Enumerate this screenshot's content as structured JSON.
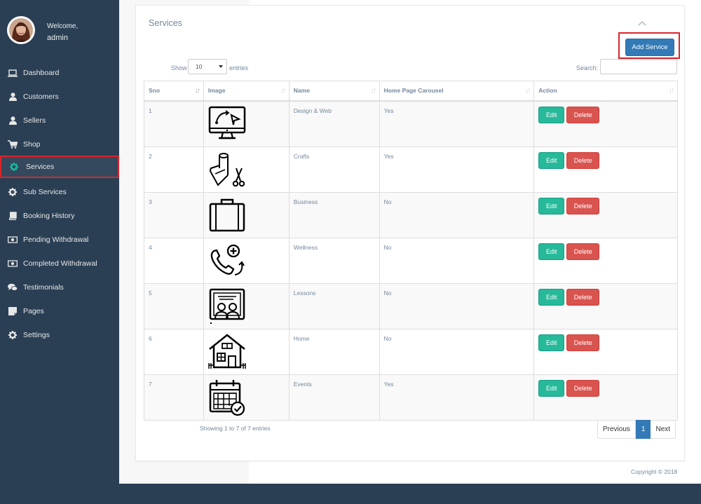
{
  "sidebar": {
    "welcome": "Welcome,",
    "username": "admin",
    "items": [
      {
        "label": "Dashboard",
        "icon": "laptop-icon"
      },
      {
        "label": "Customers",
        "icon": "user-icon"
      },
      {
        "label": "Sellers",
        "icon": "user-icon"
      },
      {
        "label": "Shop",
        "icon": "cart-icon"
      },
      {
        "label": "Services",
        "icon": "gear-icon",
        "active": true
      },
      {
        "label": "Sub Services",
        "icon": "gear-icon"
      },
      {
        "label": "Booking History",
        "icon": "book-icon"
      },
      {
        "label": "Pending Withdrawal",
        "icon": "money-icon"
      },
      {
        "label": "Completed Withdrawal",
        "icon": "money-icon"
      },
      {
        "label": "Testimonials",
        "icon": "comments-icon"
      },
      {
        "label": "Pages",
        "icon": "sticky-note-icon"
      },
      {
        "label": "Settings",
        "icon": "gear-icon"
      }
    ]
  },
  "panel": {
    "title": "Services",
    "add_button": "Add Service"
  },
  "table_controls": {
    "show": "Show",
    "entries_value": "10",
    "entries": "entries",
    "search_label": "Search:",
    "search_value": ""
  },
  "table": {
    "headers": [
      "Sno",
      "Image",
      "Name",
      "Home Page Carousel",
      "Action"
    ],
    "rows": [
      {
        "sno": "1",
        "image": "computer-screen-icon",
        "name": "Design & Web",
        "carousel": "Yes"
      },
      {
        "sno": "2",
        "image": "fabric-scissors-icon",
        "name": "Crafts",
        "carousel": "Yes"
      },
      {
        "sno": "3",
        "image": "briefcase-icon",
        "name": "Business",
        "carousel": "No"
      },
      {
        "sno": "4",
        "image": "phone-plus-icon",
        "name": "Wellness",
        "carousel": "No"
      },
      {
        "sno": "5",
        "image": "classroom-icon",
        "name": "Lessons",
        "carousel": "No"
      },
      {
        "sno": "6",
        "image": "house-icon",
        "name": "Home",
        "carousel": "No"
      },
      {
        "sno": "7",
        "image": "calendar-check-icon",
        "name": "Events",
        "carousel": "Yes"
      }
    ],
    "edit_label": "Edit",
    "delete_label": "Delete"
  },
  "footer": {
    "info": "Showing 1 to 7 of 7 entries",
    "previous": "Previous",
    "current_page": "1",
    "next": "Next",
    "copyright": "Copyright © 2018"
  },
  "colors": {
    "sidebar_bg": "#2a3f54",
    "primary": "#337ab7",
    "edit": "#26b99a",
    "delete": "#d9534f",
    "highlight": "#d9262c"
  }
}
